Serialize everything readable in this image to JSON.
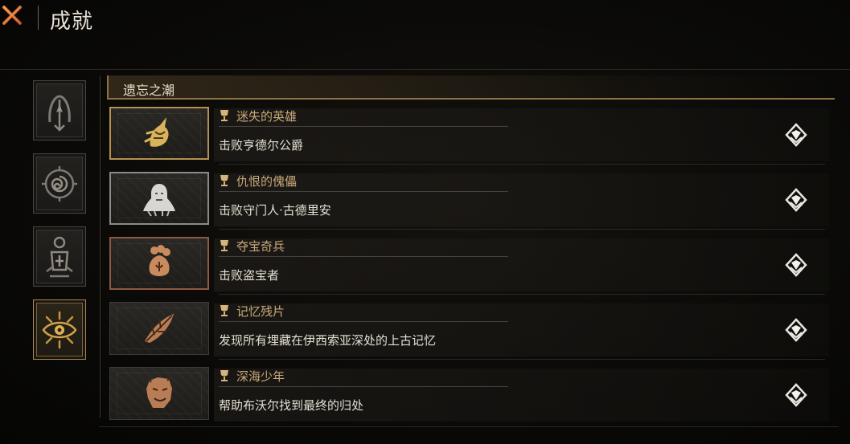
{
  "header": {
    "title": "成就"
  },
  "side_tabs": [
    {
      "icon": "arch-emblem-icon",
      "active": false
    },
    {
      "icon": "spiral-rune-icon",
      "active": false
    },
    {
      "icon": "lantern-rune-icon",
      "active": false
    },
    {
      "icon": "eye-sigil-icon",
      "active": true
    }
  ],
  "section": {
    "title": "遗忘之潮"
  },
  "achievements": [
    {
      "name": "迷失的英雄",
      "description": "击败亨德尔公爵",
      "rarity": "gold",
      "icon": "unicorn-crest-icon"
    },
    {
      "name": "仇恨的傀儡",
      "description": "击败守门人·古德里安",
      "rarity": "silver",
      "icon": "hooded-figure-icon"
    },
    {
      "name": "夺宝奇兵",
      "description": "击败盗宝者",
      "rarity": "bronze",
      "icon": "treasure-pouch-icon"
    },
    {
      "name": "记忆残片",
      "description": "发现所有埋藏在伊西索亚深处的上古记忆",
      "rarity": "bronze",
      "icon": "leaf-shard-icon"
    },
    {
      "name": "深海少年",
      "description": "帮助布沃尔找到最终的归处",
      "rarity": "bronze",
      "icon": "beast-head-icon"
    }
  ],
  "colors": {
    "accent_gold": "#b39150",
    "silver": "#8a8a86",
    "bronze": "#8d5a3e",
    "close_orange": "#e0672a"
  }
}
